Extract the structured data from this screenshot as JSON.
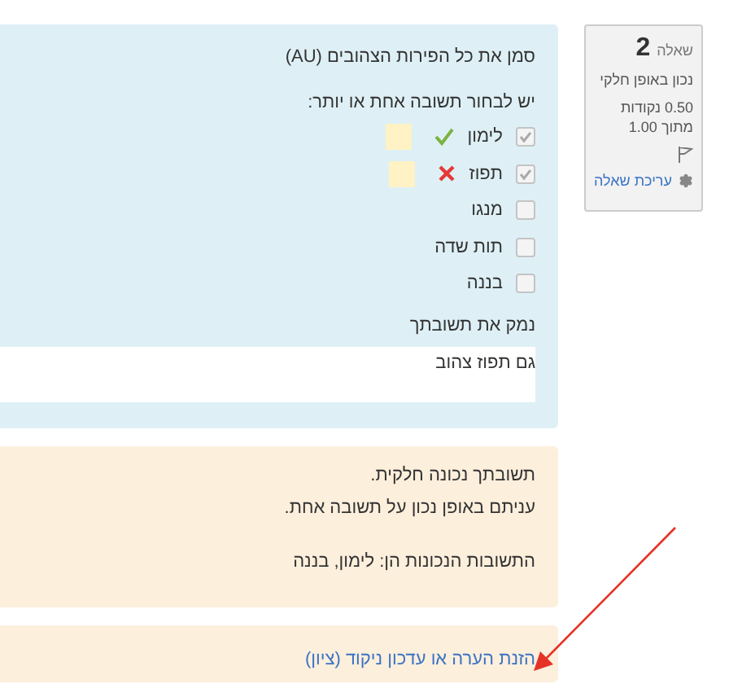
{
  "info": {
    "label": "שאלה",
    "number": "2",
    "state": "נכון באופן חלקי",
    "grade": "0.50 נקודות מתוך 1.00",
    "edit_link": "עריכת שאלה"
  },
  "question": {
    "text": "סמן את כל הפירות הצהובים (AU)",
    "prompt": "יש לבחור תשובה אחת או יותר:",
    "options": [
      {
        "label": "לימון",
        "checked": true,
        "kind": "correct"
      },
      {
        "label": "תפוז",
        "checked": true,
        "kind": "incorrect"
      },
      {
        "label": "מנגו",
        "checked": false,
        "kind": "plain"
      },
      {
        "label": "תות שדה",
        "checked": false,
        "kind": "plain"
      },
      {
        "label": "בננה",
        "checked": false,
        "kind": "plain"
      }
    ],
    "reason_label": "נמק את תשובתך",
    "reason_value": "גם תפוז צהוב"
  },
  "feedback": {
    "lines": [
      "תשובתך נכונה חלקית.",
      "עניתם באופן נכון על תשובה אחת."
    ],
    "right_answer": "התשובות הנכונות הן: לימון, בננה"
  },
  "comment_link": "הזנת הערה או עדכון ניקוד (ציון)"
}
